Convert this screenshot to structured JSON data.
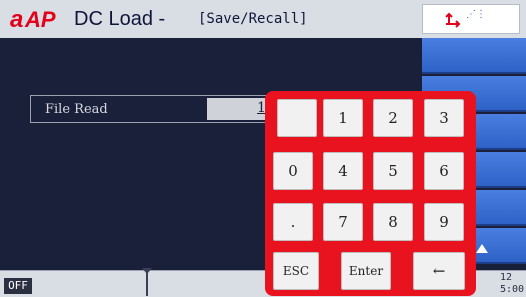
{
  "header": {
    "logo_text": "AP",
    "title": "DC Load -",
    "subtitle": "[Save/Recall]",
    "icons": [
      "usb-icon",
      "signal-icon",
      "memory-icon"
    ]
  },
  "main": {
    "file_read": {
      "label": "File Read",
      "value": "1"
    }
  },
  "keypad": {
    "keys": [
      "",
      "1",
      "2",
      "3",
      "0",
      "4",
      "5",
      "6",
      ".",
      "7",
      "8",
      "9",
      "ESC",
      "Enter",
      "←"
    ]
  },
  "status": {
    "output_state": "OFF",
    "time_line1": "12",
    "time_line2": "5:00"
  },
  "colors": {
    "background": "#1a1f3a",
    "header": "#d9dde4",
    "softkey": "#3a6fd6",
    "keypad": "#e8131e",
    "logo_red": "#e3001b"
  }
}
